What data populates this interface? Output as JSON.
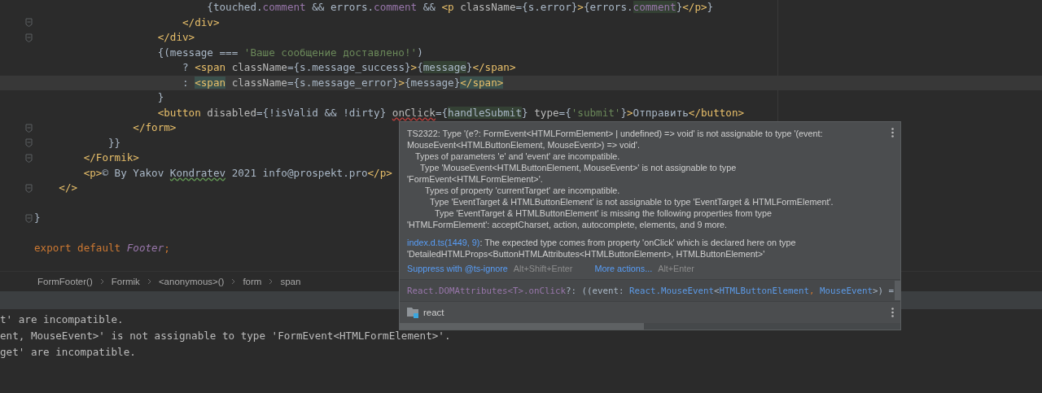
{
  "editor": {
    "lines": [
      {
        "fold": false,
        "current": false,
        "tokens": [
          {
            "text": "                            {touched.",
            "kind": "punct"
          },
          {
            "text": "comment",
            "kind": "field"
          },
          {
            "text": " && errors.",
            "kind": "punct"
          },
          {
            "text": "comment",
            "kind": "field"
          },
          {
            "text": " && ",
            "kind": "punct"
          },
          {
            "text": "<p",
            "kind": "tag"
          },
          {
            "text": " className",
            "kind": "attr"
          },
          {
            "text": "={s.error}",
            "kind": "punct"
          },
          {
            "text": ">",
            "kind": "tag"
          },
          {
            "text": "{errors.",
            "kind": "punct"
          },
          {
            "text": "comment",
            "kind": "field-match"
          },
          {
            "text": "}",
            "kind": "punct"
          },
          {
            "text": "</p>",
            "kind": "tag"
          },
          {
            "text": "}",
            "kind": "punct"
          }
        ]
      },
      {
        "fold": true,
        "current": false,
        "tokens": [
          {
            "text": "                        </div>",
            "kind": "tag"
          }
        ]
      },
      {
        "fold": true,
        "current": false,
        "tokens": [
          {
            "text": "                    </div>",
            "kind": "tag"
          }
        ]
      },
      {
        "fold": false,
        "current": false,
        "tokens": [
          {
            "text": "                    {(message === ",
            "kind": "punct"
          },
          {
            "text": "'Ваше сообщение доставлено!'",
            "kind": "string"
          },
          {
            "text": ")",
            "kind": "punct"
          }
        ]
      },
      {
        "fold": false,
        "current": false,
        "tokens": [
          {
            "text": "                        ? ",
            "kind": "punct"
          },
          {
            "text": "<span",
            "kind": "tag"
          },
          {
            "text": " className",
            "kind": "attr"
          },
          {
            "text": "={s.message_success}",
            "kind": "punct"
          },
          {
            "text": ">",
            "kind": "tag"
          },
          {
            "text": "{",
            "kind": "punct"
          },
          {
            "text": "message",
            "kind": "match"
          },
          {
            "text": "}",
            "kind": "punct"
          },
          {
            "text": "</span>",
            "kind": "tag"
          }
        ]
      },
      {
        "fold": false,
        "current": true,
        "tokens": [
          {
            "text": "                        : ",
            "kind": "punct"
          },
          {
            "text": "<span",
            "kind": "tag-match"
          },
          {
            "text": " className",
            "kind": "attr"
          },
          {
            "text": "={s.message_error}",
            "kind": "punct"
          },
          {
            "text": ">",
            "kind": "tag"
          },
          {
            "text": "{message}",
            "kind": "punct"
          },
          {
            "text": "</span>",
            "kind": "tag-match"
          }
        ]
      },
      {
        "fold": false,
        "current": false,
        "tokens": [
          {
            "text": "                    }",
            "kind": "punct"
          }
        ]
      },
      {
        "fold": false,
        "current": false,
        "tokens": [
          {
            "text": "                    <button",
            "kind": "tag"
          },
          {
            "text": " disabled",
            "kind": "attr"
          },
          {
            "text": "={!isValid && !dirty} ",
            "kind": "punct"
          },
          {
            "text": "onClick",
            "kind": "error"
          },
          {
            "text": "={",
            "kind": "punct"
          },
          {
            "text": "handleSubmit",
            "kind": "match"
          },
          {
            "text": "} ",
            "kind": "punct"
          },
          {
            "text": "type",
            "kind": "attr"
          },
          {
            "text": "={",
            "kind": "punct"
          },
          {
            "text": "'submit'",
            "kind": "string"
          },
          {
            "text": "}",
            "kind": "punct"
          },
          {
            "text": ">",
            "kind": "tag"
          },
          {
            "text": "Отправить",
            "kind": "text"
          },
          {
            "text": "</button>",
            "kind": "tag"
          }
        ]
      },
      {
        "fold": true,
        "current": false,
        "tokens": [
          {
            "text": "                </form>",
            "kind": "tag"
          }
        ]
      },
      {
        "fold": true,
        "current": false,
        "tokens": [
          {
            "text": "            }}",
            "kind": "punct"
          }
        ]
      },
      {
        "fold": true,
        "current": false,
        "tokens": [
          {
            "text": "        </Formik>",
            "kind": "tag"
          }
        ]
      },
      {
        "fold": false,
        "current": false,
        "tokens": [
          {
            "text": "        <p>",
            "kind": "tag"
          },
          {
            "text": "© By Yakov ",
            "kind": "text"
          },
          {
            "text": "Kondratev",
            "kind": "typo"
          },
          {
            "text": " 2021 info@prospekt.pro",
            "kind": "text"
          },
          {
            "text": "</p>",
            "kind": "tag"
          }
        ]
      },
      {
        "fold": true,
        "current": false,
        "tokens": [
          {
            "text": "    </>",
            "kind": "tag"
          }
        ]
      },
      {
        "fold": false,
        "current": false
      },
      {
        "fold": true,
        "current": false,
        "tokens": [
          {
            "text": "}",
            "kind": "punct"
          }
        ]
      },
      {
        "fold": false,
        "current": false
      },
      {
        "fold": false,
        "current": false,
        "tokens": [
          {
            "text": "export default ",
            "kind": "keyword"
          },
          {
            "text": "Footer",
            "kind": "component"
          },
          {
            "text": ";",
            "kind": "keyword"
          }
        ]
      },
      {
        "fold": false,
        "current": false
      }
    ]
  },
  "breadcrumbs": [
    "FormFooter()",
    "Formik",
    "<anonymous>()",
    "form",
    "span"
  ],
  "popup": {
    "message": {
      "text": "TS2322: Type '(e?: FormEvent<HTMLFormElement> | undefined) => void' is not assignable to type '(event: MouseEvent<HTMLButtonElement, MouseEvent>) => void'.",
      "children": [
        {
          "text": "Types of parameters 'e' and 'event' are incompatible.",
          "children": [
            {
              "text": "Type 'MouseEvent<HTMLButtonElement, MouseEvent>' is not assignable to type 'FormEvent<HTMLFormElement>'.",
              "children": [
                {
                  "text": "Types of property 'currentTarget' are incompatible.",
                  "children": [
                    {
                      "text": "Type 'EventTarget & HTMLButtonElement' is not assignable to type 'EventTarget & HTMLFormElement'.",
                      "children": [
                        {
                          "text": "Type 'EventTarget & HTMLButtonElement' is missing the following properties from type 'HTMLFormElement': acceptCharset, action, autocomplete, elements, and 9 more."
                        }
                      ]
                    }
                  ]
                }
              ]
            }
          ]
        }
      ]
    },
    "hint": {
      "link": "index.d.ts(1449, 9)",
      "text": ": The expected type comes from property 'onClick' which is declared here on type 'DetailedHTMLProps<ButtonHTMLAttributes<HTMLButtonElement>, HTMLButtonElement>'"
    },
    "actions": [
      {
        "label": "Suppress with @ts-ignore",
        "shortcut": "Alt+Shift+Enter"
      },
      {
        "label": "More actions...",
        "shortcut": "Alt+Enter"
      }
    ],
    "signature": [
      {
        "text": "React.DOMAttributes<T>.onClick",
        "kind": "field"
      },
      {
        "text": "?: ((event: ",
        "kind": "text"
      },
      {
        "text": "React.MouseEvent",
        "kind": "type"
      },
      {
        "text": "<",
        "kind": "text"
      },
      {
        "text": "HTMLButtonElement",
        "kind": "type"
      },
      {
        "text": ", ",
        "kind": "keyword"
      },
      {
        "text": "MouseEvent",
        "kind": "type"
      },
      {
        "text": ">) =",
        "kind": "text"
      }
    ],
    "module": "react"
  },
  "console": {
    "lines": [
      "t' are incompatible.",
      "ent, MouseEvent>' is not assignable to type 'FormEvent<HTMLFormElement>'.",
      "get' are incompatible."
    ]
  }
}
